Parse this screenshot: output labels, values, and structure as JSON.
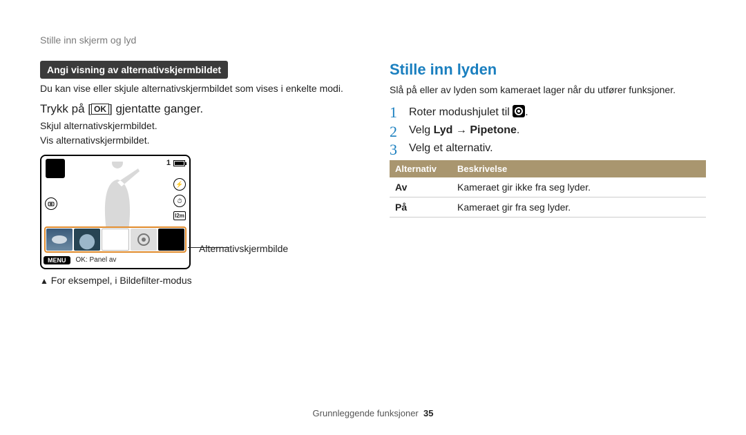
{
  "running_head": "Stille inn skjerm og lyd",
  "left": {
    "tag_heading": "Angi visning av alternativskjermbildet",
    "intro": "Du kan vise eller skjule alternativskjermbildet som vises i enkelte modi.",
    "instruction_pre": "Trykk på [",
    "ok_label": "OK",
    "instruction_post": "] gjentatte ganger.",
    "sub1": "Skjul alternativskjermbildet.",
    "sub2": "Vis alternativskjermbildet.",
    "lcd": {
      "count": "1",
      "menu_label": "MENU",
      "panel_label": "OK: Panel av"
    },
    "annot": "Alternativskjermbilde",
    "footnote_marker": "▲",
    "footnote": "For eksempel, i Bildefilter-modus"
  },
  "right": {
    "heading": "Stille inn lyden",
    "intro": "Slå på eller av lyden som kameraet lager når du utfører funksjoner.",
    "step1_pre": "Roter modushjulet til ",
    "step1_post": ".",
    "step2_pre": "Velg ",
    "step2_b1": "Lyd",
    "step2_arrow": " → ",
    "step2_b2": "Pipetone",
    "step2_post": ".",
    "step3": "Velg et alternativ.",
    "table": {
      "head_alt": "Alternativ",
      "head_desc": "Beskrivelse",
      "rows": [
        {
          "k": "Av",
          "v": "Kameraet gir ikke fra seg lyder."
        },
        {
          "k": "På",
          "v": "Kameraet gir fra seg lyder."
        }
      ]
    }
  },
  "footer": {
    "section": "Grunnleggende funksjoner",
    "page": "35"
  }
}
